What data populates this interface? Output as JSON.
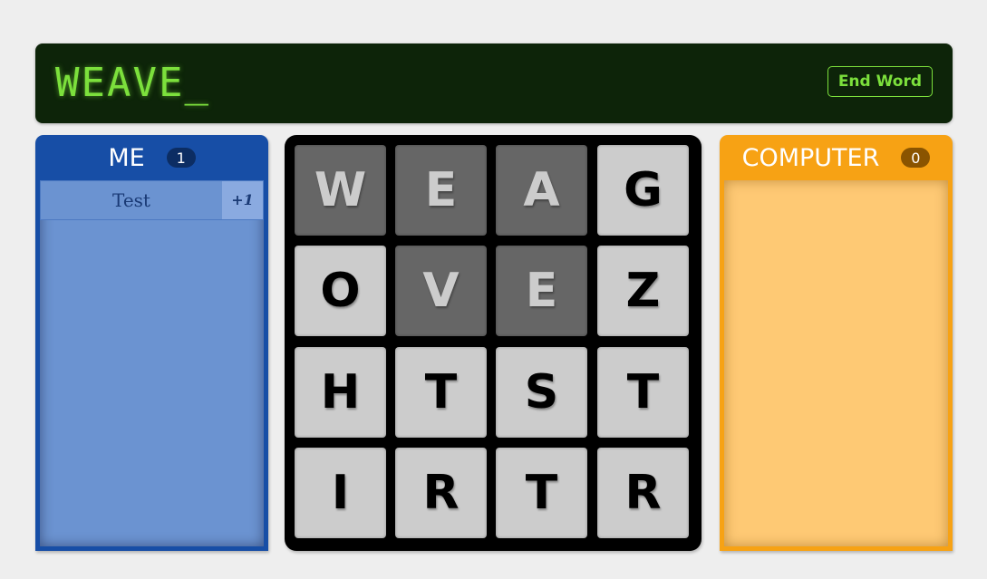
{
  "header": {
    "current_word": "WEAVE_",
    "end_word_label": "End Word",
    "display_color": "#7ce03c"
  },
  "players": {
    "me": {
      "name": "ME",
      "score": "1",
      "color": "#174ea6",
      "words": [
        {
          "word": "Test",
          "points": "+1"
        }
      ]
    },
    "computer": {
      "name": "COMPUTER",
      "score": "0",
      "color": "#f7a214",
      "words": []
    }
  },
  "board": {
    "rows": [
      [
        {
          "letter": "W",
          "used": true
        },
        {
          "letter": "E",
          "used": true
        },
        {
          "letter": "A",
          "used": true
        },
        {
          "letter": "G",
          "used": false
        }
      ],
      [
        {
          "letter": "O",
          "used": false
        },
        {
          "letter": "V",
          "used": true
        },
        {
          "letter": "E",
          "used": true
        },
        {
          "letter": "Z",
          "used": false
        }
      ],
      [
        {
          "letter": "H",
          "used": false
        },
        {
          "letter": "T",
          "used": false
        },
        {
          "letter": "S",
          "used": false
        },
        {
          "letter": "T",
          "used": false
        }
      ],
      [
        {
          "letter": "I",
          "used": false
        },
        {
          "letter": "R",
          "used": false
        },
        {
          "letter": "T",
          "used": false
        },
        {
          "letter": "R",
          "used": false
        }
      ]
    ]
  }
}
